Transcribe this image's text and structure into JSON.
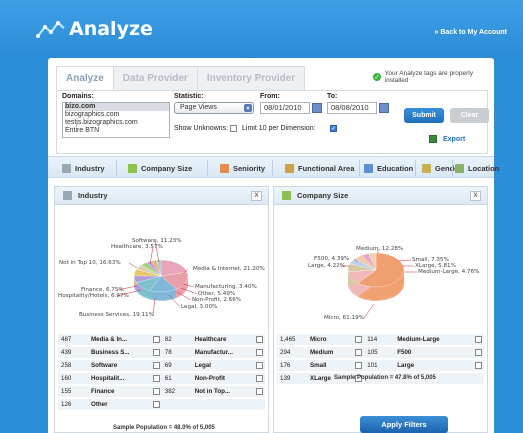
{
  "app": {
    "title": "Analyze",
    "back_link": "» Back to My Account"
  },
  "tabs": [
    {
      "label": "Analyze"
    },
    {
      "label": "Data Provider"
    },
    {
      "label": "Inventory Provider"
    }
  ],
  "status_message": "Your Analyze tags are properly installed",
  "filters": {
    "domains_label": "Domains:",
    "domains": [
      "bizo.com",
      "bizographics.com",
      "testjs.bizographics.com",
      "Entire BTN"
    ],
    "statistic_label": "Statistic:",
    "statistic_value": "Page Views",
    "from_label": "From:",
    "from_value": "08/01/2010",
    "to_label": "To:",
    "to_value": "08/08/2010",
    "show_unknowns_label": "Show Unknowns:",
    "limit_label": "Limit 10 per Dimension:",
    "submit_label": "Submit",
    "clear_label": "Clear",
    "export_label": "Export"
  },
  "categories": [
    {
      "label": "Industry",
      "icon": "industry-icon"
    },
    {
      "label": "Company Size",
      "icon": "company-size-icon"
    },
    {
      "label": "Seniority",
      "icon": "seniority-icon"
    },
    {
      "label": "Functional Area",
      "icon": "functional-area-icon"
    },
    {
      "label": "Education",
      "icon": "education-icon"
    },
    {
      "label": "Gender",
      "icon": "gender-icon"
    },
    {
      "label": "Location",
      "icon": "location-icon"
    }
  ],
  "industry_card": {
    "title": "Industry",
    "close": "X",
    "chart_labels": [
      "Software, 11.23%",
      "Healthcare, 3.57%",
      "Not in Top 10, 16.63%",
      "Media & Internet, 21.20%",
      "Manufacturing, 3.40%",
      "Other, 5.49%",
      "Non-Profit, 2.66%",
      "Legal, 3.00%",
      "Finance, 6.75%",
      "Hospitality/Hotels, 6.97%",
      "Business Services, 19.11%"
    ],
    "rows": [
      [
        "487",
        "Media & In...",
        "82",
        "Healthcare"
      ],
      [
        "439",
        "Business S...",
        "78",
        "Manufactur..."
      ],
      [
        "258",
        "Software",
        "69",
        "Legal"
      ],
      [
        "160",
        "Hospitalit...",
        "61",
        "Non-Profit"
      ],
      [
        "155",
        "Finance",
        "382",
        "Not in Top..."
      ],
      [
        "126",
        "Other",
        "",
        ""
      ]
    ],
    "sample": "Sample Population = 48.0% of 5,005"
  },
  "company_card": {
    "title": "Company Size",
    "close": "X",
    "chart_labels": [
      "Medium, 12.28%",
      "F500, 4.39%",
      "Large, 4.22%",
      "Small, 7.35%",
      "XLarge, 5.81%",
      "Medium-Large, 4.76%",
      "Micro, 61.19%"
    ],
    "rows": [
      [
        "1,465",
        "Micro",
        "114",
        "Medium-Large"
      ],
      [
        "294",
        "Medium",
        "105",
        "F500"
      ],
      [
        "176",
        "Small",
        "101",
        "Large"
      ],
      [
        "139",
        "XLarge",
        "",
        ""
      ]
    ],
    "sample": "Sample Population = 47.8% of 5,005"
  },
  "apply_label": "Apply Filters",
  "chart_data": [
    {
      "type": "pie",
      "title": "Industry",
      "categories": [
        "Media & Internet",
        "Business Services",
        "Not in Top 10",
        "Software",
        "Hospitality/Hotels",
        "Finance",
        "Other",
        "Healthcare",
        "Manufacturing",
        "Legal",
        "Non-Profit"
      ],
      "values": [
        21.2,
        19.11,
        16.63,
        11.23,
        6.97,
        6.75,
        5.49,
        3.57,
        3.4,
        3.0,
        2.66
      ]
    },
    {
      "type": "pie",
      "title": "Company Size",
      "categories": [
        "Micro",
        "Medium",
        "Small",
        "XLarge",
        "Medium-Large",
        "F500",
        "Large"
      ],
      "values": [
        61.19,
        12.28,
        7.35,
        5.81,
        4.76,
        4.39,
        4.22
      ]
    }
  ],
  "colors": {
    "brand": "#2a8fd8",
    "submit": "#1f6fba",
    "status_ok": "#3bb83b"
  }
}
